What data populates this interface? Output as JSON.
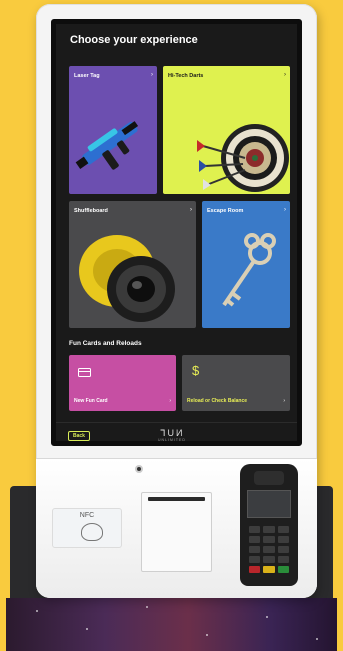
{
  "screen": {
    "title": "Choose your experience"
  },
  "tiles": [
    {
      "label": "Laser Tag",
      "chevron": "›"
    },
    {
      "label": "Hi-Tech Darts",
      "chevron": "›"
    },
    {
      "label": "Shuffleboard",
      "chevron": "›"
    },
    {
      "label": "Escape Room",
      "chevron": "›"
    }
  ],
  "fun_cards": {
    "section_title": "Fun Cards and Reloads",
    "new_card_label": "New Fun Card",
    "reload_label": "Reload or Check Balance",
    "dollar_symbol": "$",
    "chevron": "›"
  },
  "footer": {
    "back_label": "Back",
    "brand": "ᒣUИ",
    "brand_sub": "UNLIMITED"
  },
  "hardware": {
    "nfc_label": "NFC"
  },
  "colors": {
    "background": "#f9cb3e",
    "laser_tag": "#6c4fb0",
    "darts": "#dff14f",
    "shuffleboard": "#4a4a4c",
    "escape_room": "#3a7ac8",
    "fun_card": "#c64fa3",
    "accent": "#d8ec58"
  }
}
